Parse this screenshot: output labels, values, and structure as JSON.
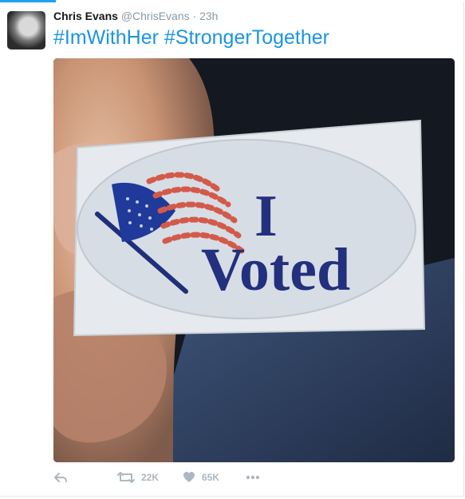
{
  "tweet": {
    "author_name": "Chris Evans",
    "handle": "@ChrisEvans",
    "separator": "·",
    "timestamp": "23h",
    "text": "#ImWithHer #StrongerTogether"
  },
  "media": {
    "sticker_line1": "I",
    "sticker_line2": "Voted"
  },
  "actions": {
    "retweet_count": "22K",
    "like_count": "65K"
  },
  "colors": {
    "accent": "#1b95e0",
    "action_gray": "#aab8c2"
  }
}
